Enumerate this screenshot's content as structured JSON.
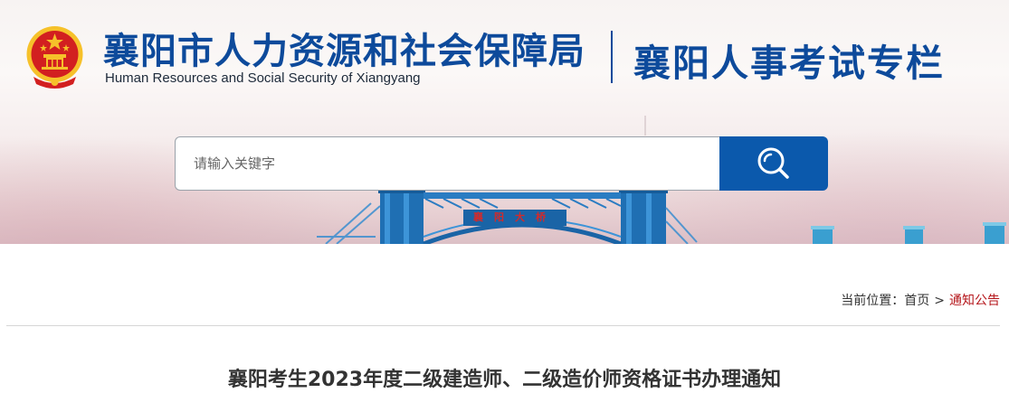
{
  "header": {
    "org_name_cn": "襄阳市人力资源和社会保障局",
    "org_name_en": "Human Resources and Social Security of Xiangyang",
    "section_title": "襄阳人事考试专栏",
    "bridge_sign": "襄阳大桥"
  },
  "search": {
    "placeholder": "请输入关键字",
    "value": ""
  },
  "breadcrumb": {
    "label": "当前位置：",
    "home": "首页",
    "separator": ">",
    "current": "通知公告"
  },
  "article": {
    "title": "襄阳考生2023年度二级建造师、二级造价师资格证书办理通知"
  },
  "colors": {
    "brand_blue": "#0d4a9b",
    "button_blue": "#0b59ac",
    "breadcrumb_current": "#b5161b",
    "bridge_blue": "#1f6fb3",
    "emblem_red": "#d21f20",
    "emblem_gold": "#f6c12a"
  },
  "icons": {
    "search": "search-icon",
    "emblem": "national-emblem-icon"
  }
}
